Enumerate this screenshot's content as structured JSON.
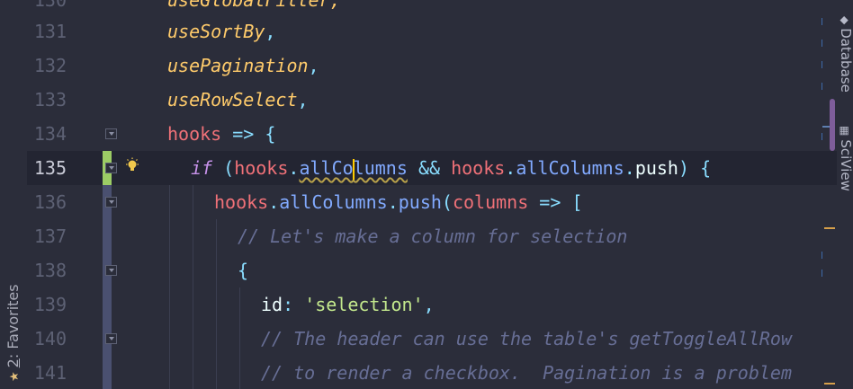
{
  "favorites_tab": {
    "number": "2",
    "label": ": Favorites"
  },
  "side_tabs": {
    "database": "Database",
    "sciview": "SciView"
  },
  "partial_top_line": "useGlobalFilter,",
  "lines": [
    {
      "number": "131",
      "text": "useSortBy,"
    },
    {
      "number": "132",
      "text": "usePagination,"
    },
    {
      "number": "133",
      "text": "useRowSelect,"
    },
    {
      "number": "134",
      "text": "hooks => {"
    },
    {
      "number": "135",
      "text": "if (hooks.allColumns && hooks.allColumns.push) {"
    },
    {
      "number": "136",
      "text": "hooks.allColumns.push(columns => ["
    },
    {
      "number": "137",
      "text": "// Let's make a column for selection"
    },
    {
      "number": "138",
      "text": "{"
    },
    {
      "number": "139",
      "text": "id: 'selection',"
    },
    {
      "number": "140",
      "text": "// The header can use the table's getToggleAllRow"
    },
    {
      "number": "141",
      "text": "// to render a checkbox.  Pagination is a problem"
    }
  ],
  "icons": {
    "bulb": "lightbulb-icon",
    "star": "star-icon",
    "fold": "fold-marker-icon"
  },
  "colors": {
    "background": "#2b2d3a",
    "current_line": "#232532",
    "function": "#ffcb6b",
    "keyword": "#c792ea",
    "property": "#82aaff",
    "variable": "#f07178",
    "string": "#c3e88d",
    "comment": "#676e95",
    "vcs_added": "#9ccc65",
    "vcs_modified": "#4a5070"
  }
}
